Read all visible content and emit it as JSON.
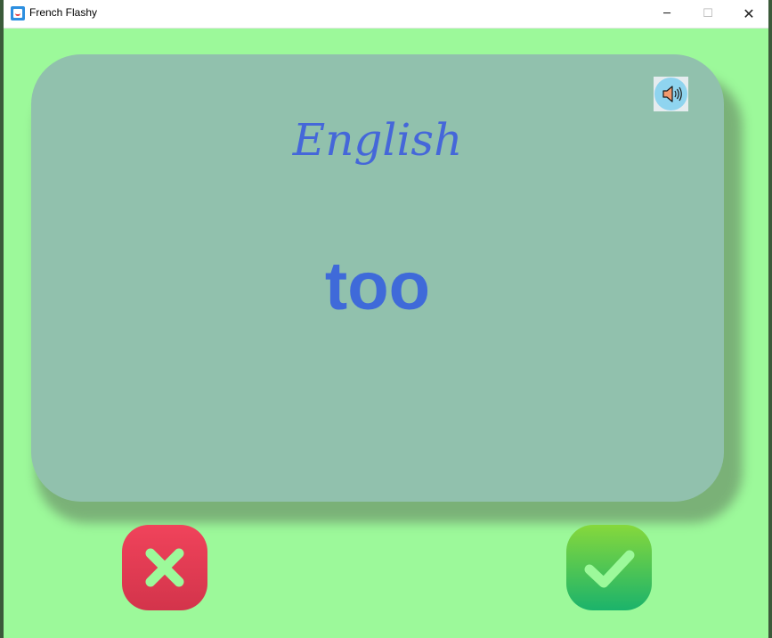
{
  "window": {
    "title": "French Flashy",
    "minimize_glyph": "─",
    "maximize_glyph": "☐",
    "close_glyph": "✕"
  },
  "card": {
    "title": "English",
    "word": "too"
  },
  "icons": {
    "app": "flashcard-app-icon",
    "speaker": "speaker-icon",
    "wrong": "cross-icon",
    "right": "check-icon"
  },
  "colors": {
    "background": "#9cf99a",
    "card": "#91c1ad",
    "text": "#4567d9",
    "wrong_button": "#e03c54",
    "right_button": "#4cc550",
    "button_glyph": "#9cf99a"
  }
}
